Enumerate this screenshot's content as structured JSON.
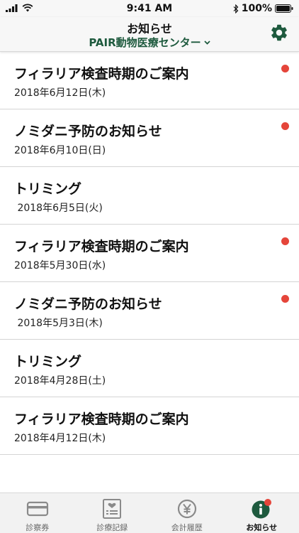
{
  "status_bar": {
    "time": "9:41 AM",
    "battery_percent": "100%"
  },
  "nav": {
    "title": "お知らせ",
    "subtitle": "PAIR動物医療センター",
    "accent_color": "#1e5a3e"
  },
  "notifications": [
    {
      "title": "フィラリア検査時期のご案内",
      "date": "2018年6月12日(木)",
      "unread": true
    },
    {
      "title": "ノミダニ予防のお知らせ",
      "date": "2018年6月10日(日)",
      "unread": true
    },
    {
      "title": "トリミング",
      "date": " 2018年6月5日(火)",
      "unread": false
    },
    {
      "title": "フィラリア検査時期のご案内",
      "date": "2018年5月30日(水)",
      "unread": true
    },
    {
      "title": "ノミダニ予防のお知らせ",
      "date": " 2018年5月3日(木)",
      "unread": true
    },
    {
      "title": "トリミング",
      "date": "2018年4月28日(土)",
      "unread": false
    },
    {
      "title": "フィラリア検査時期のご案内",
      "date": "2018年4月12日(木)",
      "unread": false
    }
  ],
  "tabs": [
    {
      "label": "診察券",
      "icon": "card-icon",
      "active": false
    },
    {
      "label": "診療記録",
      "icon": "medical-record-icon",
      "active": false
    },
    {
      "label": "会計履歴",
      "icon": "yen-icon",
      "active": false
    },
    {
      "label": "お知らせ",
      "icon": "info-icon",
      "active": true
    }
  ],
  "colors": {
    "unread_dot": "#e5453a",
    "active_tab": "#1e5a3e"
  }
}
